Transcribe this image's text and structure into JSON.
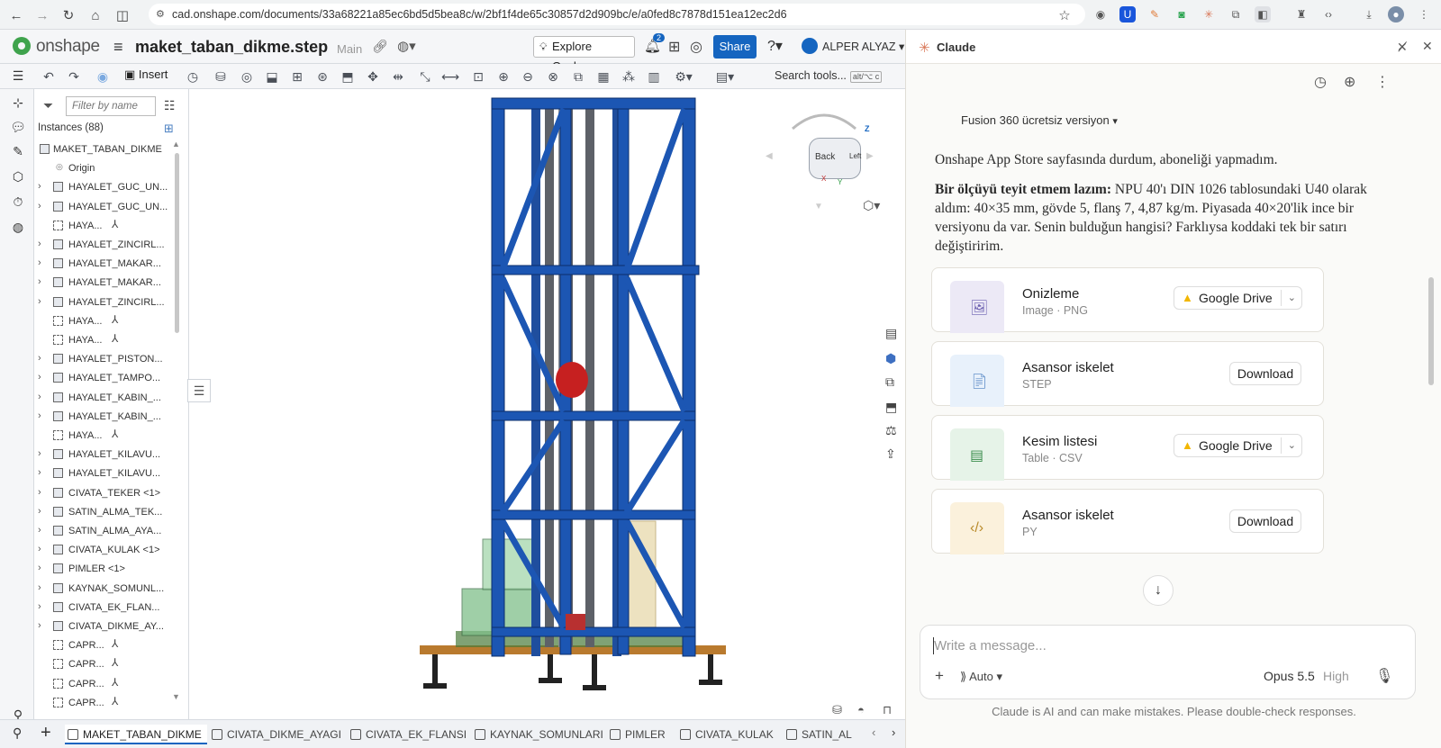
{
  "browser": {
    "url": "cad.onshape.com/documents/33a68221a85ec6bd5d5bea8c/w/2bf1f4de65c30857d2d909bc/e/a0fed8c7878d151ea12ec2d6",
    "icons": [
      "back-icon",
      "forward-icon",
      "reload-icon",
      "home-icon",
      "sidebar-icon",
      "star-icon",
      "download-icon"
    ]
  },
  "onshape": {
    "brand": "onshape",
    "doc_title": "maket_taban_dikme.step",
    "branch": "Main",
    "explore_label": "Explore Onshape",
    "notification_count": "2",
    "share_label": "Share",
    "user_name": "ALPER ALYAZ",
    "insert_label": "Insert",
    "search_tools": "Search tools...",
    "search_kbd": "alt/⌥ c",
    "filter_placeholder": "Filter by name",
    "instances_label": "Instances (88)",
    "tree": [
      {
        "label": "MAKET_TABAN_DIKME",
        "kind": "root"
      },
      {
        "label": "Origin",
        "kind": "origin"
      },
      {
        "label": "HAYALET_GUC_UN...",
        "kind": "part"
      },
      {
        "label": "HAYALET_GUC_UN...",
        "kind": "part"
      },
      {
        "label": "HAYA...",
        "kind": "mate"
      },
      {
        "label": "HAYALET_ZINCIRL...",
        "kind": "part"
      },
      {
        "label": "HAYALET_MAKAR...",
        "kind": "part"
      },
      {
        "label": "HAYALET_MAKAR...",
        "kind": "part"
      },
      {
        "label": "HAYALET_ZINCIRL...",
        "kind": "part"
      },
      {
        "label": "HAYA...",
        "kind": "mate"
      },
      {
        "label": "HAYA...",
        "kind": "mate"
      },
      {
        "label": "HAYALET_PISTON...",
        "kind": "part"
      },
      {
        "label": "HAYALET_TAMPO...",
        "kind": "part"
      },
      {
        "label": "HAYALET_KABIN_...",
        "kind": "part"
      },
      {
        "label": "HAYALET_KABIN_...",
        "kind": "part"
      },
      {
        "label": "HAYA...",
        "kind": "mate"
      },
      {
        "label": "HAYALET_KILAVU...",
        "kind": "part"
      },
      {
        "label": "HAYALET_KILAVU...",
        "kind": "part"
      },
      {
        "label": "CIVATA_TEKER <1>",
        "kind": "part"
      },
      {
        "label": "SATIN_ALMA_TEK...",
        "kind": "part"
      },
      {
        "label": "SATIN_ALMA_AYA...",
        "kind": "part"
      },
      {
        "label": "CIVATA_KULAK <1>",
        "kind": "part"
      },
      {
        "label": "PIMLER <1>",
        "kind": "part"
      },
      {
        "label": "KAYNAK_SOMUNL...",
        "kind": "part"
      },
      {
        "label": "CIVATA_EK_FLAN...",
        "kind": "part"
      },
      {
        "label": "CIVATA_DIKME_AY...",
        "kind": "part"
      },
      {
        "label": "CAPR...",
        "kind": "mate"
      },
      {
        "label": "CAPR...",
        "kind": "mate"
      },
      {
        "label": "CAPR...",
        "kind": "mate"
      },
      {
        "label": "CAPR...",
        "kind": "mate"
      }
    ],
    "viewcube": {
      "back": "Back",
      "left": "Left",
      "z": "Z",
      "x": "X",
      "y": "Y"
    },
    "tabs": [
      "MAKET_TABAN_DIKME",
      "CIVATA_DIKME_AYAGI",
      "CIVATA_EK_FLANSI",
      "KAYNAK_SOMUNLARI",
      "PIMLER",
      "CIVATA_KULAK",
      "SATIN_AL"
    ],
    "active_tab": "MAKET_TABAN_DIKME"
  },
  "claude": {
    "title": "Claude",
    "prev_message": "Fusion 360 ücretsiz versiyon",
    "msg1": "Onshape App Store sayfasında durdum, aboneliği yapmadım.",
    "msg2_bold": "Bir ölçüyü teyit etmem lazım:",
    "msg2_rest": " NPU 40'ı DIN 1026 tablosundaki U40 olarak aldım: 40×35 mm, gövde 5, flanş 7, 4,87 kg/m. Piyasada 40×20'lik ince bir versiyonu da var. Senin bulduğun hangisi? Farklıysa koddaki tek bir satırı değiştiririm.",
    "cards": [
      {
        "title": "Onizleme",
        "sub": "Image · PNG",
        "action": "Google Drive",
        "type": "drive",
        "thumb": "#ece9f6",
        "icon_color": "#6b5fb0",
        "icon": "image-icon"
      },
      {
        "title": "Asansor iskelet",
        "sub": "STEP",
        "action": "Download",
        "type": "download",
        "thumb": "#e8f1fb",
        "icon_color": "#4a7fc1",
        "icon": "file-icon"
      },
      {
        "title": "Kesim listesi",
        "sub": "Table · CSV",
        "action": "Google Drive",
        "type": "drive",
        "thumb": "#e6f3e8",
        "icon_color": "#3d8f4f",
        "icon": "table-icon"
      },
      {
        "title": "Asansor iskelet",
        "sub": "PY",
        "action": "Download",
        "type": "download",
        "thumb": "#fbf1dc",
        "icon_color": "#b98a2a",
        "icon": "code-icon"
      }
    ],
    "input_placeholder": "Write a message...",
    "mode_label": "Auto",
    "model_label": "Opus 5.5",
    "effort_label": "High",
    "disclaimer": "Claude is AI and can make mistakes. Please double-check responses."
  }
}
